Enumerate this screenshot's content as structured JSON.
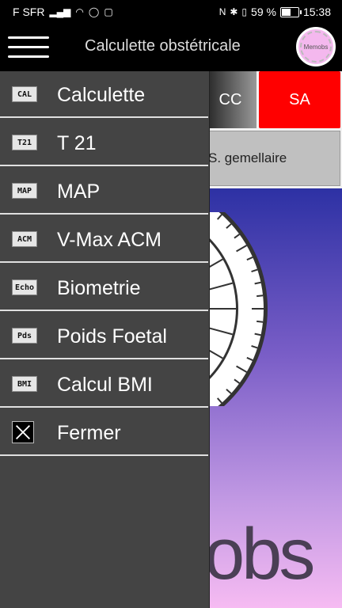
{
  "status_bar": {
    "carrier": "F SFR",
    "battery": "59 %",
    "battery_level": 0.59,
    "time": "15:38"
  },
  "app_bar": {
    "title": "Calculette obstétricale",
    "logo_text": "Memobs"
  },
  "tabs": {
    "cc_label": "CC",
    "sa_label": "SA"
  },
  "background": {
    "gemellaire_label": "S. gemellaire",
    "wheel_text": "bs",
    "hero_text": "obs"
  },
  "drawer": {
    "items": [
      {
        "icon": "CAL",
        "label": "Calculette"
      },
      {
        "icon": "T21",
        "label": "T 21"
      },
      {
        "icon": "MAP",
        "label": "MAP"
      },
      {
        "icon": "ACM",
        "label": "V-Max ACM"
      },
      {
        "icon": "Echo",
        "label": "Biometrie"
      },
      {
        "icon": "Pds",
        "label": "Poids Foetal"
      },
      {
        "icon": "BMI",
        "label": "Calcul BMI"
      },
      {
        "icon": "close-icon",
        "label": "Fermer"
      }
    ]
  },
  "colors": {
    "drawer_bg": "#444444",
    "sa_tab": "#ff0000",
    "hero_top": "#2d31a4",
    "hero_bottom": "#f6bbf2"
  }
}
